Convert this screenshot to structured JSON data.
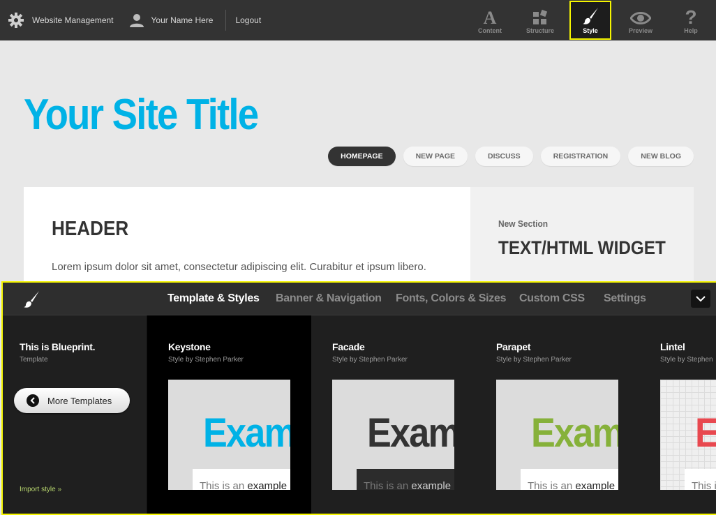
{
  "topbar": {
    "site_management": "Website Management",
    "username": "Your Name Here",
    "logout": "Logout",
    "tools": [
      {
        "label": "Content",
        "icon": "letter-a-icon"
      },
      {
        "label": "Structure",
        "icon": "blocks-icon"
      },
      {
        "label": "Style",
        "icon": "paintbrush-icon",
        "active": true
      },
      {
        "label": "Preview",
        "icon": "eye-icon"
      },
      {
        "label": "Help",
        "icon": "question-icon"
      }
    ],
    "highlight_color": "#f5f500"
  },
  "site": {
    "title": "Your Site Title",
    "title_color": "#00b2e6",
    "nav": [
      "HOMEPAGE",
      "NEW PAGE",
      "DISCUSS",
      "REGISTRATION",
      "NEW BLOG"
    ],
    "nav_active": "HOMEPAGE",
    "header": "HEADER",
    "body": "Lorem ipsum dolor sit amet, consectetur adipiscing elit. Curabitur et ipsum libero.",
    "sidebar_kicker": "New Section",
    "sidebar_title": "TEXT/HTML WIDGET"
  },
  "panel": {
    "tabs": [
      "Template & Styles",
      "Banner & Navigation",
      "Fonts, Colors & Sizes",
      "Custom CSS",
      "Settings"
    ],
    "active_tab": "Template & Styles",
    "template_name": "This is Blueprint.",
    "template_label": "Template",
    "more_templates": "More Templates",
    "import_style": "Import style »",
    "styles": [
      {
        "name": "Keystone",
        "by": "Style by Stephen Parker",
        "word": "Exam",
        "word_color": "#00b2e6",
        "sample_plain": "This is an ",
        "sample_bold": "example",
        "selected": true
      },
      {
        "name": "Facade",
        "by": "Style by Stephen Parker",
        "word": "Exam",
        "word_color": "#333333",
        "sample_plain": "This is an ",
        "sample_bold": "example"
      },
      {
        "name": "Parapet",
        "by": "Style by Stephen Parker",
        "word": "Exam",
        "word_color": "#86b13a",
        "sample_plain": "This is an ",
        "sample_bold": "example"
      },
      {
        "name": "Lintel",
        "by": "Style by Stephen",
        "word": "E",
        "word_color": "#e8484f",
        "sample_plain": "This i",
        "sample_bold": ""
      }
    ]
  }
}
